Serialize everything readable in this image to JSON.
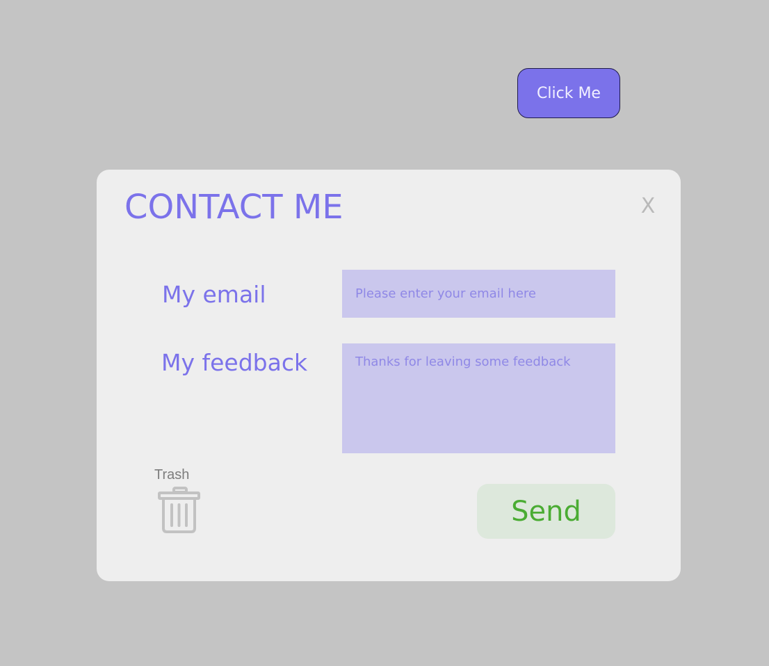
{
  "top_button": {
    "label": "Click Me"
  },
  "modal": {
    "title": "CONTACT ME",
    "close_label": "X",
    "email": {
      "label": "My email",
      "placeholder": "Please enter your email here",
      "value": ""
    },
    "feedback": {
      "label": "My feedback",
      "placeholder": "Thanks for leaving some feedback",
      "value": ""
    },
    "trash": {
      "label": "Trash",
      "icon": "trash-icon"
    },
    "send": {
      "label": "Send"
    }
  },
  "colors": {
    "background": "#c4c4c4",
    "modal_background": "#eeeeee",
    "accent": "#7b72ea",
    "input_background": "#cac7ed",
    "send_text": "#4aac33",
    "send_background": "#dde8dc",
    "muted": "#b9b9b9"
  }
}
